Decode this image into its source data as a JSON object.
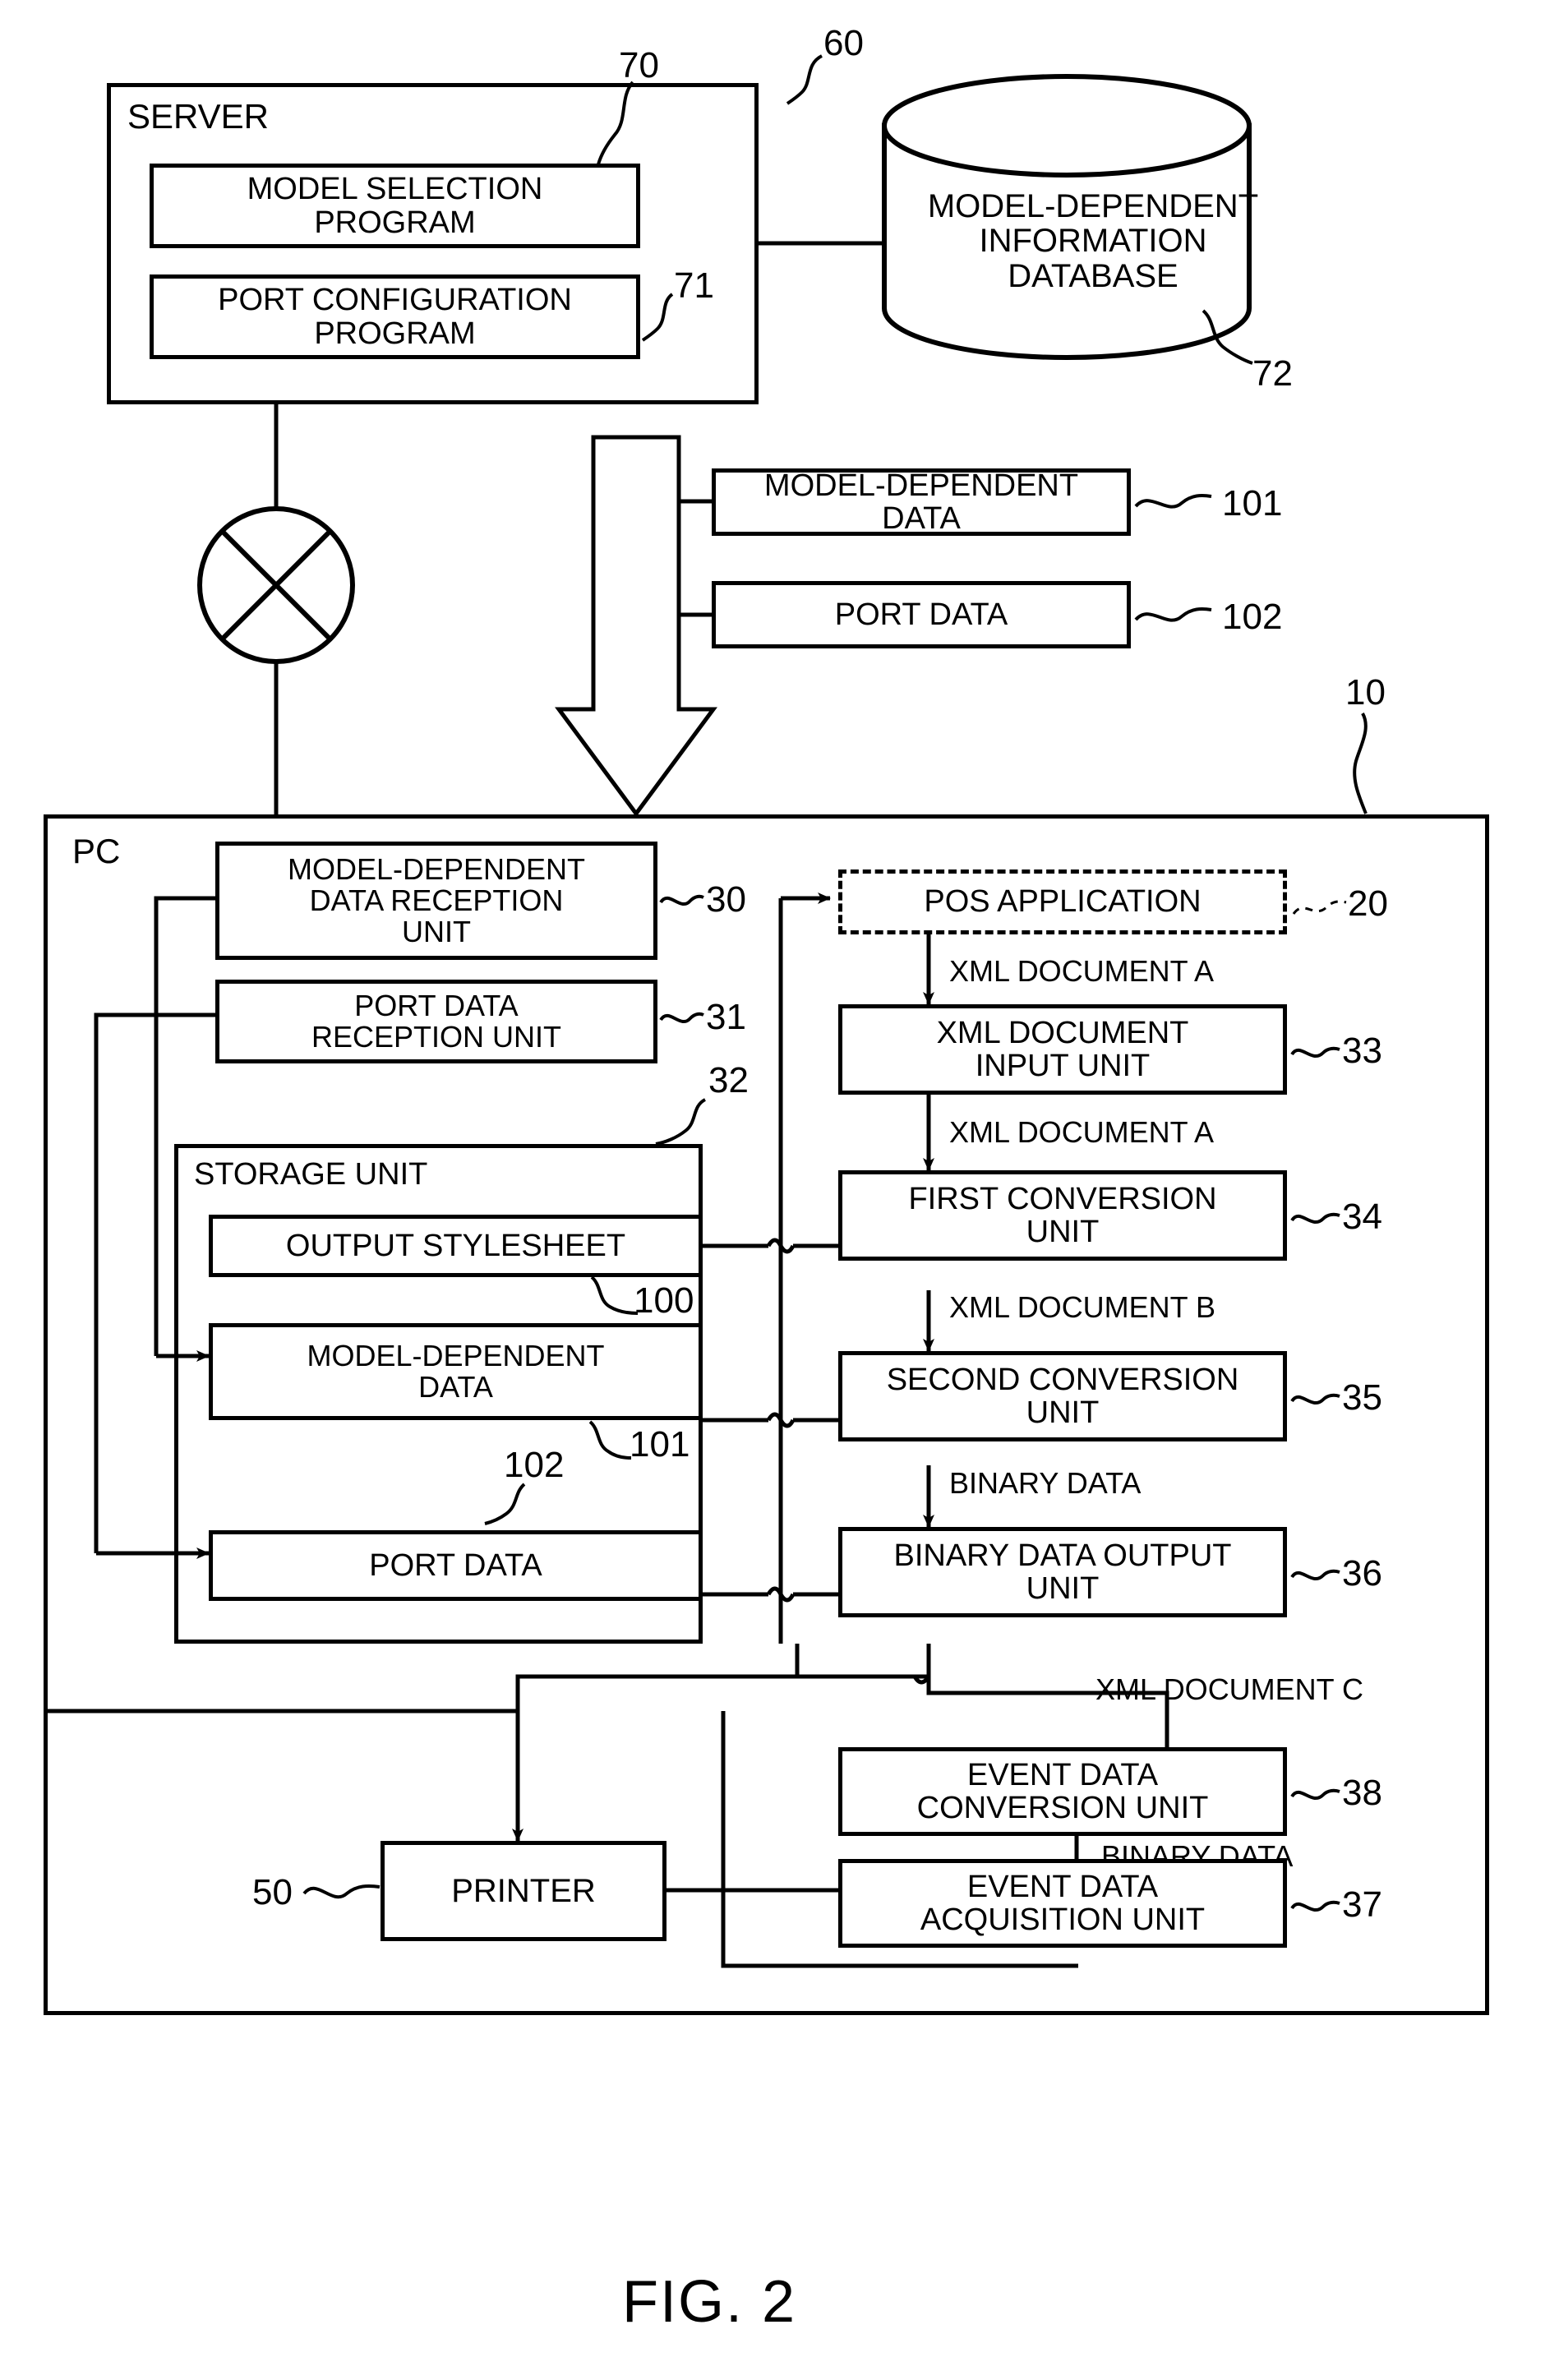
{
  "figure": {
    "caption": "FIG. 2"
  },
  "server": {
    "title": "SERVER",
    "ref": "60",
    "programs": [
      {
        "label": "MODEL SELECTION\nPROGRAM",
        "ref": "70"
      },
      {
        "label": "PORT CONFIGURATION\nPROGRAM",
        "ref": "71"
      }
    ]
  },
  "database": {
    "label": "MODEL-DEPENDENT\nINFORMATION\nDATABASE",
    "ref": "72"
  },
  "network": {
    "icon": "crossed-circle-network-icon"
  },
  "transfer": {
    "arrow_icon": "hollow-down-arrow-icon",
    "items": [
      {
        "label": "MODEL-DEPENDENT\nDATA",
        "ref": "101"
      },
      {
        "label": "PORT DATA",
        "ref": "102"
      }
    ]
  },
  "pc": {
    "title": "PC",
    "ref": "10",
    "reception_units": [
      {
        "label": "MODEL-DEPENDENT\nDATA RECEPTION\nUNIT",
        "ref": "30"
      },
      {
        "label": "PORT DATA\nRECEPTION UNIT",
        "ref": "31"
      }
    ],
    "storage": {
      "title": "STORAGE UNIT",
      "ref": "32",
      "items": [
        {
          "label": "OUTPUT STYLESHEET",
          "ref": "100"
        },
        {
          "label": "MODEL-DEPENDENT\nDATA",
          "ref": "101"
        },
        {
          "label": "PORT DATA",
          "ref": "102"
        }
      ]
    },
    "pipeline": [
      {
        "label": "POS APPLICATION",
        "ref": "20",
        "style": "dashed"
      },
      {
        "label": "XML DOCUMENT\nINPUT UNIT",
        "ref": "33",
        "style": "solid"
      },
      {
        "label": "FIRST CONVERSION\nUNIT",
        "ref": "34",
        "style": "solid"
      },
      {
        "label": "SECOND CONVERSION\nUNIT",
        "ref": "35",
        "style": "solid"
      },
      {
        "label": "BINARY DATA OUTPUT\nUNIT",
        "ref": "36",
        "style": "solid"
      }
    ],
    "event_units": [
      {
        "label": "EVENT DATA\nCONVERSION UNIT",
        "ref": "38"
      },
      {
        "label": "EVENT DATA\nACQUISITION UNIT",
        "ref": "37"
      }
    ],
    "flow_labels": [
      "XML DOCUMENT A",
      "XML DOCUMENT A",
      "XML DOCUMENT B",
      "BINARY DATA",
      "XML DOCUMENT C",
      "BINARY DATA"
    ]
  },
  "printer": {
    "label": "PRINTER",
    "ref": "50"
  },
  "colors": {
    "line": "#000000",
    "background": "#ffffff"
  }
}
